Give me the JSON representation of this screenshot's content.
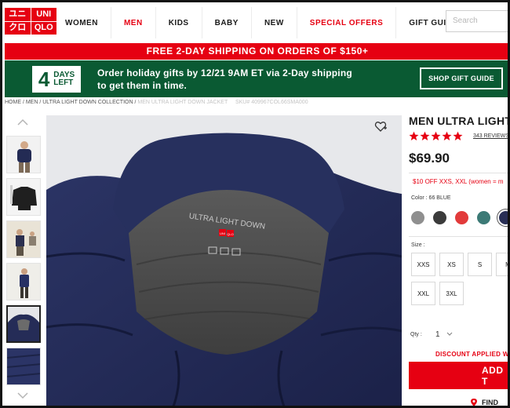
{
  "logo": {
    "cells": [
      "ユニ",
      "UNI",
      "クロ",
      "QLO"
    ]
  },
  "nav": {
    "items": [
      {
        "label": "WOMEN",
        "highlight": false
      },
      {
        "label": "MEN",
        "highlight": true
      },
      {
        "label": "KIDS",
        "highlight": false
      },
      {
        "label": "BABY",
        "highlight": false
      },
      {
        "label": "NEW",
        "highlight": false
      },
      {
        "label": "SPECIAL OFFERS",
        "highlight": true
      },
      {
        "label": "GIFT GUIDE",
        "highlight": false
      }
    ]
  },
  "search": {
    "placeholder": "Search"
  },
  "shipping_bar": {
    "text": "FREE 2-DAY SHIPPING ON ORDERS OF $150+"
  },
  "banner": {
    "days_number": "4",
    "days_label_1": "DAYS",
    "days_label_2": "LEFT",
    "message_line_1": "Order holiday gifts by 12/21 9AM ET via 2-Day shipping",
    "message_line_2": "to get them in time.",
    "button_label": "SHOP GIFT GUIDE"
  },
  "breadcrumb": {
    "items": [
      "HOME",
      "MEN",
      "ULTRA LIGHT DOWN COLLECTION"
    ],
    "faded_item": "MEN ULTRA LIGHT DOWN JACKET",
    "sku": "SKU# 409967COL66SMA000",
    "separator": " / "
  },
  "image": {
    "tag_brand_text": "ULTRA LIGHT DOWN",
    "tag_logo": [
      "UNI",
      "QLO"
    ]
  },
  "product": {
    "title": "MEN ULTRA LIGHT",
    "rating": 5,
    "reviews": "343 REVIEWS",
    "price": "$69.90",
    "discount": "$10 OFF XXS, XXL (women = m",
    "color_label": "Color : 66 BLUE",
    "colors": [
      "#8f8f8f",
      "#3b3b3b",
      "#e23b3b",
      "#3c7a76",
      "#282e55"
    ],
    "active_color_index": 4,
    "size_label": "Size :",
    "sizes_row1": [
      "XXS",
      "XS",
      "S",
      "M"
    ],
    "sizes_row2": [
      "XXL",
      "3XL"
    ],
    "qty_label": "Qty :",
    "qty_value": "1",
    "applied": "DISCOUNT APPLIED W",
    "add_button": "ADD T",
    "find_link": "FIND"
  }
}
